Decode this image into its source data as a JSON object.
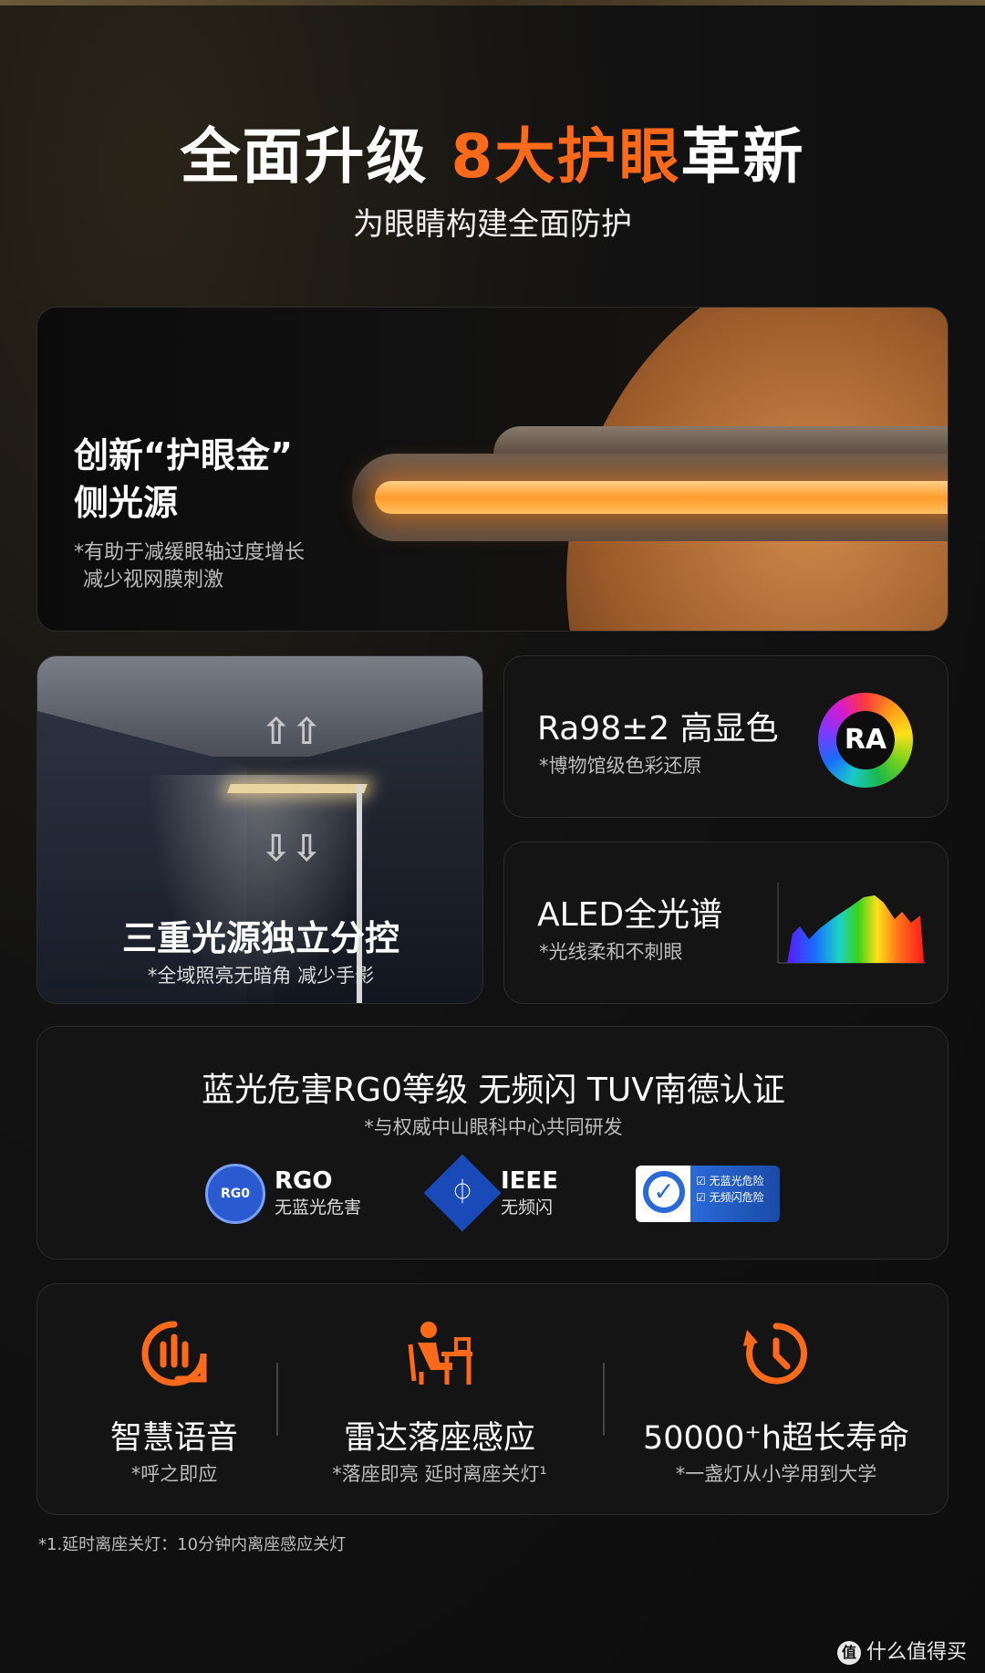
{
  "hero": {
    "title_prefix": "全面升级",
    "title_highlight": "8大护眼",
    "title_suffix": "革新",
    "subtitle": "为眼睛构建全面防护"
  },
  "card_side_light": {
    "title_line1": "创新“护眼金”",
    "title_line2": "侧光源",
    "note_line1": "*有助于减缓眼轴过度增长",
    "note_line2": "减少视网膜刺激"
  },
  "card_triple": {
    "title": "三重光源独立分控",
    "note": "*全域照亮无暗角 减少手影",
    "arrow_up": "⇧⇧",
    "arrow_down": "⇩⇩"
  },
  "card_ra": {
    "title": "Ra98±2  高显色",
    "note": "*博物馆级色彩还原",
    "badge": "RA"
  },
  "card_aled": {
    "title": "ALED全光谱",
    "note": "*光线柔和不刺眼"
  },
  "card_cert": {
    "title": "蓝光危害RG0等级  无频闪  TUV南德认证",
    "note": "*与权威中山眼科中心共同研发",
    "rgo": {
      "badge": "RG0",
      "big": "RGO",
      "small": "无蓝光危害"
    },
    "ieee": {
      "big": "IEEE",
      "small": "无频闪"
    },
    "tuv": {
      "line1": "☑ 无蓝光危险",
      "line2": "☑ 无频闪危险"
    }
  },
  "features": [
    {
      "icon": "voice-icon",
      "title": "智慧语音",
      "note": "*呼之即应"
    },
    {
      "icon": "radar-seat-icon",
      "title": "雷达落座感应",
      "note": "*落座即亮 延时离座关灯¹"
    },
    {
      "icon": "timer-icon",
      "title": "50000⁺h超长寿命",
      "note": "*一盏灯从小学用到大学"
    }
  ],
  "footnote": "*1.延时离座关灯：10分钟内离座感应关灯",
  "watermark": "什么值得买",
  "colors": {
    "accent": "#ff6a1a",
    "background": "#121212"
  }
}
